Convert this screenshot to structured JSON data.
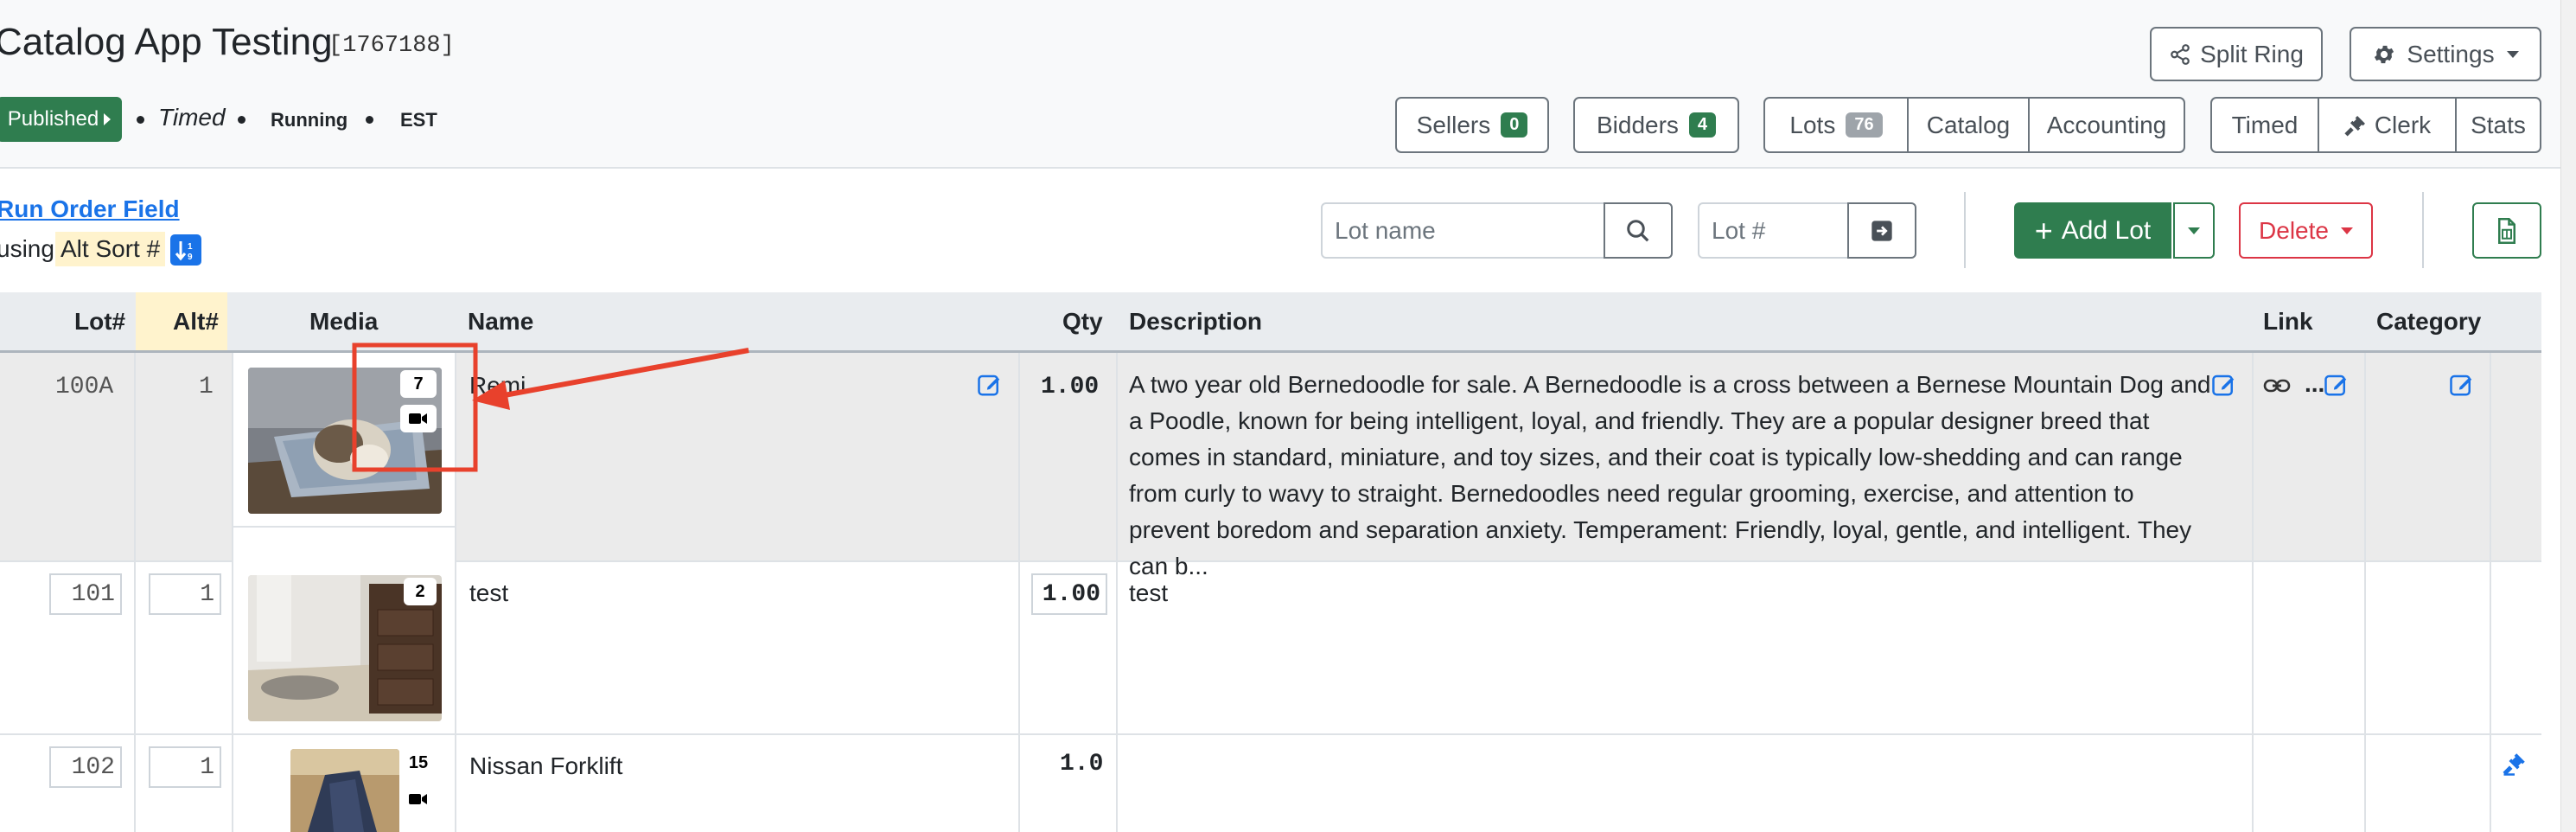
{
  "header": {
    "title": "Catalog App Testing",
    "app_id": "[1767188]",
    "status_button": "Published",
    "mode": "Timed",
    "state": "Running",
    "timezone": "EST",
    "split_ring": "Split Ring",
    "settings": "Settings",
    "sellers": {
      "label": "Sellers",
      "count": "0"
    },
    "bidders": {
      "label": "Bidders",
      "count": "4"
    },
    "lots": {
      "label": "Lots",
      "count": "76"
    },
    "catalog": "Catalog",
    "accounting": "Accounting",
    "timed": "Timed",
    "clerk": "Clerk",
    "stats": "Stats"
  },
  "toolbar": {
    "run_order_link": "Run Order Field",
    "using_prefix": "using",
    "sort_field": "Alt Sort #",
    "lot_name_placeholder": "Lot name",
    "lot_num_placeholder": "Lot #",
    "add_lot": "Add Lot",
    "delete": "Delete"
  },
  "table": {
    "columns": [
      "Lot#",
      "Alt#",
      "Media",
      "Name",
      "Qty",
      "Description",
      "Link",
      "Category"
    ],
    "rows": [
      {
        "lot": "100A",
        "alt": "1",
        "media_count": "7",
        "name": "Remi",
        "qty": "1.00",
        "description": "A two year old Bernedoodle for sale. A Bernedoodle is a cross between a Bernese Mountain Dog and a Poodle, known for being intelligent, loyal, and friendly. They are a popular designer breed that comes in standard, miniature, and toy sizes, and their coat is typically low-shedding and can range from curly to wavy to straight. Bernedoodles need regular grooming, exercise, and attention to prevent boredom and separation anxiety.  Temperament: Friendly, loyal, gentle, and intelligent. They can b...",
        "link_ellipsis": "..."
      },
      {
        "lot": "101",
        "alt": "1",
        "media_count": "2",
        "name": "test",
        "qty": "1.00",
        "description": "test"
      },
      {
        "lot": "102",
        "alt": "1",
        "media_count": "15",
        "name": "Nissan Forklift",
        "qty": "1.0",
        "description": ""
      }
    ]
  },
  "colors": {
    "primary_green": "#2f7d4f",
    "danger_red": "#dc3545",
    "link_blue": "#1a73e8",
    "annotation_red": "#e8412c",
    "sort_highlight": "#fff3cd"
  }
}
